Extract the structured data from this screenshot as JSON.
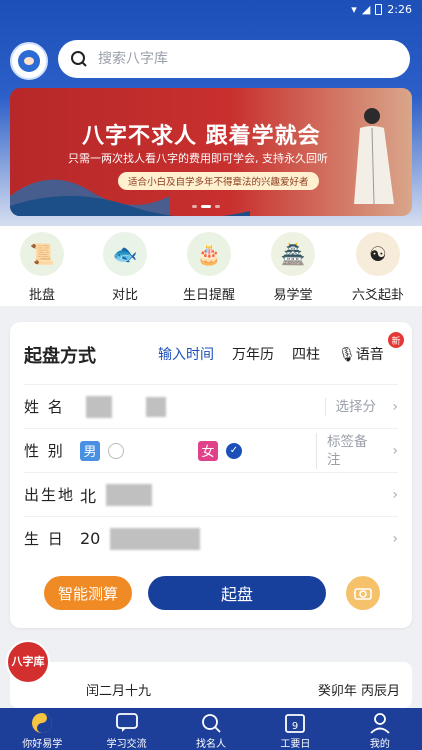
{
  "status": {
    "time": "2:26"
  },
  "search": {
    "placeholder": "搜索八字库"
  },
  "banner": {
    "title": "八字不求人 跟着学就会",
    "subtitle": "只需一两次找人看八字的费用即可学会, 支持永久回听",
    "tag": "适合小白及自学多年不得章法的兴趣爱好者"
  },
  "quick": [
    {
      "label": "批盘",
      "icon": "paper-icon",
      "color": "#e9f2e3"
    },
    {
      "label": "对比",
      "icon": "koi-fish-icon",
      "color": "#eaf3e8"
    },
    {
      "label": "生日提醒",
      "icon": "cake-icon",
      "color": "#e9f2e3"
    },
    {
      "label": "易学堂",
      "icon": "temple-icon",
      "color": "#eef2e3"
    },
    {
      "label": "六爻起卦",
      "icon": "bagua-icon",
      "color": "#f7ecd9"
    }
  ],
  "card": {
    "title": "起盘方式",
    "tabs": [
      "输入时间",
      "万年历",
      "四柱",
      "语音"
    ],
    "badge": "新",
    "name_label": "姓 名",
    "name_right": "选择分",
    "gender_label": "性 别",
    "male": "男",
    "female": "女",
    "gender_right": "标签备注",
    "birthplace_label": "出生地",
    "birthplace_value": "北",
    "birthday_label": "生 日",
    "birthday_value": "20",
    "btn_smart": "智能测算",
    "btn_start": "起盘"
  },
  "calendar": {
    "lunar": "闰二月十九",
    "ganzhi": "癸卯年 丙辰月"
  },
  "float_logo": "八字库",
  "nav": [
    {
      "label": "你好易学",
      "icon": "taiji-icon"
    },
    {
      "label": "学习交流",
      "icon": "chat-icon"
    },
    {
      "label": "找名人",
      "icon": "search-icon"
    },
    {
      "label": "工要日",
      "icon": "calendar-icon"
    },
    {
      "label": "我的",
      "icon": "user-icon"
    }
  ]
}
